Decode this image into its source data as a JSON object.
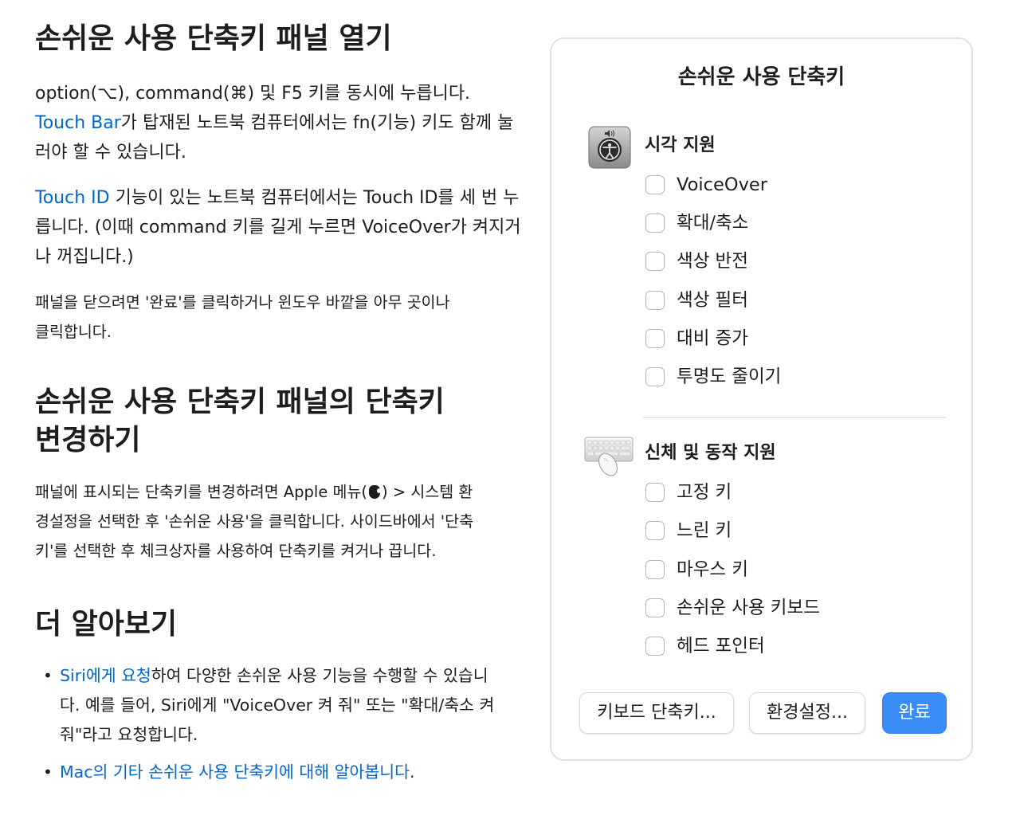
{
  "article": {
    "section1": {
      "title": "손쉬운 사용 단축키 패널 열기",
      "p1_part1": "option(⌥), command(⌘) 및 F5 키를 동시에 누릅니다. ",
      "p1_link": "Touch Bar",
      "p1_part2": "가 탑재된 노트북 컴퓨터에서는 fn(기능) 키도 함께 눌러야 할 수 있습니다.",
      "p2_link": "Touch ID",
      "p2_part1": " 기능이 있는 노트북 컴퓨터에서는 Touch ID를 세 번 누릅니다. (이때 command 키를 길게 누르면 VoiceOver가 켜지거나 꺼집니다.)",
      "p3": "패널을 닫으려면 '완료'를 클릭하거나 윈도우 바깥을 아무 곳이나 클릭합니다."
    },
    "section2": {
      "title_line1": "손쉬운 사용 단축키 패널의 단축키",
      "title_line2": "변경하기",
      "p1_part1": "패널에 표시되는 단축키를 변경하려면 Apple 메뉴(",
      "p1_part2": ") > 시스템 환경설정을 선택한 후 '손쉬운 사용'을 클릭합니다. 사이드바에서 '단축키'를 선택한 후 체크상자를 사용하여 단축키를 켜거나 끕니다."
    },
    "section3": {
      "title": "더 알아보기",
      "bullet": "•",
      "item1_link": "Siri에게 요청",
      "item1_text": "하여 다양한 손쉬운 사용 기능을 수행할 수 있습니다. 예를 들어, Siri에게 \"VoiceOver 켜 줘\" 또는 \"확대/축소 켜 줘\"라고 요청합니다.",
      "item2_link": "Mac의 기타 손쉬운 사용 단축키에 대해 알아봅니다",
      "item2_text": "."
    }
  },
  "panel": {
    "title": "손쉬운 사용 단축키",
    "vision": {
      "title": "시각 지원",
      "icon": "accessibility-icon",
      "items": [
        "VoiceOver",
        "확대/축소",
        "색상 반전",
        "색상 필터",
        "대비 증가",
        "투명도 줄이기"
      ]
    },
    "motor": {
      "title": "신체 및 동작 지원",
      "icon": "keyboard-mouse-icon",
      "items": [
        "고정 키",
        "느린 키",
        "마우스 키",
        "손쉬운 사용 키보드",
        "헤드 포인터"
      ]
    },
    "buttons": {
      "keyboard_shortcuts": "키보드 단축키...",
      "preferences": "환경설정...",
      "done": "완료"
    },
    "colors": {
      "accent": "#3a8cf7",
      "link": "#0066cc"
    }
  }
}
